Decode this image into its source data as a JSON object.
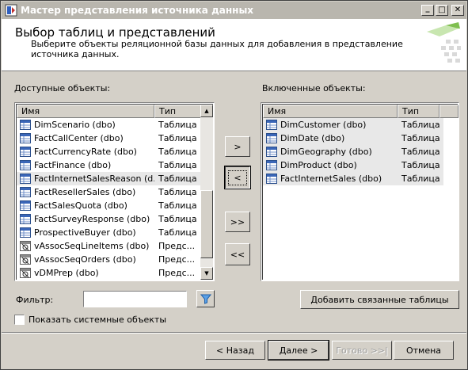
{
  "window": {
    "title": "Мастер представления источника данных",
    "buttons": {
      "minimize": "_",
      "maximize": "□",
      "close": "✕"
    }
  },
  "header": {
    "title": "Выбор таблиц и представлений",
    "subtitle": "Выберите объекты реляционной базы данных для добавления в представление источника данных."
  },
  "available": {
    "label": "Доступные объекты:",
    "columns": {
      "name": "Имя",
      "type": "Тип"
    },
    "items": [
      {
        "name": "DimScenario (dbo)",
        "type": "Таблица",
        "kind": "table"
      },
      {
        "name": "FactCallCenter (dbo)",
        "type": "Таблица",
        "kind": "table"
      },
      {
        "name": "FactCurrencyRate (dbo)",
        "type": "Таблица",
        "kind": "table"
      },
      {
        "name": "FactFinance (dbo)",
        "type": "Таблица",
        "kind": "table"
      },
      {
        "name": "FactInternetSalesReason (d...",
        "type": "Таблица",
        "kind": "table"
      },
      {
        "name": "FactResellerSales (dbo)",
        "type": "Таблица",
        "kind": "table"
      },
      {
        "name": "FactSalesQuota (dbo)",
        "type": "Таблица",
        "kind": "table"
      },
      {
        "name": "FactSurveyResponse (dbo)",
        "type": "Таблица",
        "kind": "table"
      },
      {
        "name": "ProspectiveBuyer (dbo)",
        "type": "Таблица",
        "kind": "table"
      },
      {
        "name": "vAssocSeqLineItems (dbo)",
        "type": "Предс...",
        "kind": "view"
      },
      {
        "name": "vAssocSeqOrders (dbo)",
        "type": "Предс...",
        "kind": "view"
      },
      {
        "name": "vDMPrep (dbo)",
        "type": "Предс...",
        "kind": "view"
      }
    ]
  },
  "included": {
    "label": "Включенные объекты:",
    "columns": {
      "name": "Имя",
      "type": "Тип"
    },
    "items": [
      {
        "name": "DimCustomer (dbo)",
        "type": "Таблица",
        "kind": "table"
      },
      {
        "name": "DimDate (dbo)",
        "type": "Таблица",
        "kind": "table"
      },
      {
        "name": "DimGeography (dbo)",
        "type": "Таблица",
        "kind": "table"
      },
      {
        "name": "DimProduct (dbo)",
        "type": "Таблица",
        "kind": "table"
      },
      {
        "name": "FactInternetSales (dbo)",
        "type": "Таблица",
        "kind": "table"
      }
    ]
  },
  "transfer": {
    "add": ">",
    "remove": "<",
    "add_all": ">>",
    "remove_all": "<<"
  },
  "filter": {
    "label": "Фильтр:",
    "value": ""
  },
  "add_related_button": "Добавить связанные таблицы",
  "show_system": {
    "label": "Показать системные объекты",
    "checked": false
  },
  "footer": {
    "back": "< Назад",
    "next": "Далее >",
    "finish": "Готово >>|",
    "cancel": "Отмена"
  },
  "icons": {
    "app": "data-source-view-icon",
    "table": "table-icon",
    "view": "view-icon",
    "filter": "funnel-filter-icon",
    "header_art": "wizard-header-art"
  },
  "colors": {
    "titlebar": "#b9b6ae",
    "face": "#d4d0c8",
    "selected_row": "#e8e8e8"
  }
}
